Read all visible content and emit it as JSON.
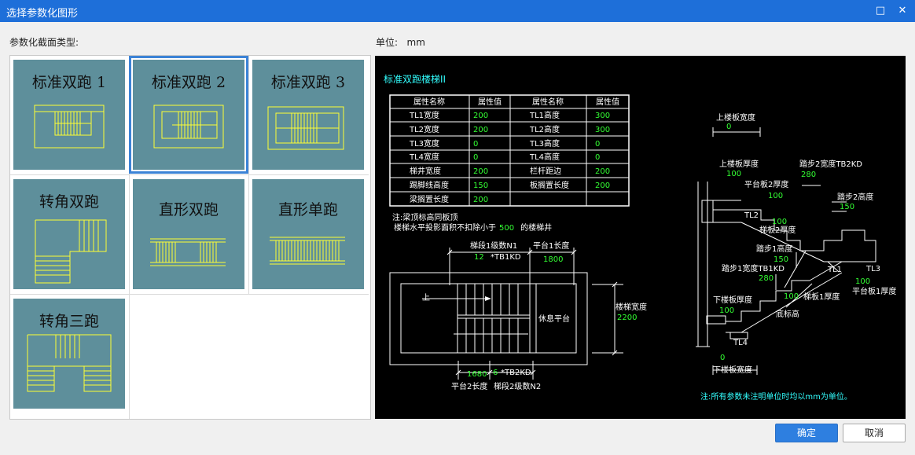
{
  "window": {
    "title": "选择参数化图形"
  },
  "left_label": "参数化截面类型:",
  "unit": {
    "label": "单位:",
    "value": "mm"
  },
  "gallery": {
    "items": [
      {
        "label": "标准双跑 1",
        "selected": false
      },
      {
        "label": "标准双跑 2",
        "selected": true
      },
      {
        "label": "标准双跑 3",
        "selected": false
      },
      {
        "label": "转角双跑",
        "selected": false
      },
      {
        "label": "直形双跑",
        "selected": false
      },
      {
        "label": "直形单跑",
        "selected": false
      },
      {
        "label": "转角三跑",
        "selected": false
      }
    ]
  },
  "preview": {
    "title": "标准双跑楼梯II",
    "table": {
      "headers": [
        "属性名称",
        "属性值",
        "属性名称",
        "属性值"
      ],
      "rows": [
        [
          "TL1宽度",
          "200",
          "TL1高度",
          "300"
        ],
        [
          "TL2宽度",
          "200",
          "TL2高度",
          "300"
        ],
        [
          "TL3宽度",
          "0",
          "TL3高度",
          "0"
        ],
        [
          "TL4宽度",
          "0",
          "TL4高度",
          "0"
        ],
        [
          "梯井宽度",
          "200",
          "栏杆距边",
          "200"
        ],
        [
          "踢脚线高度",
          "150",
          "板搁置长度",
          "200"
        ],
        [
          "梁搁置长度",
          "200",
          "",
          ""
        ]
      ]
    },
    "note1": "注:梁顶标高同板顶",
    "note2_prefix": "楼梯水平投影面积不扣除小于",
    "note2_value": "500",
    "note2_suffix": "的楼梯井",
    "plan": {
      "seg1_label": "梯段1级数N1",
      "seg1_value": "12",
      "seg1_code": "*TB1KD",
      "plat1_label": "平台1长度",
      "plat1_value": "1800",
      "up_label": "上",
      "rest_label": "休息平台",
      "width_label": "楼梯宽度",
      "width_value": "2200",
      "plat2_value": "1680",
      "seg2_value": "6",
      "seg2_code": "*TB2KD",
      "plat2_label": "平台2长度",
      "seg2_label": "梯段2级数N2"
    },
    "section": {
      "upper_slab_width_label": "上楼板宽度",
      "upper_slab_width_value": "0",
      "upper_slab_thk_label": "上楼板厚度",
      "upper_slab_thk_value": "100",
      "step2_width_label": "踏步2宽度TB2KD",
      "step2_width_value": "280",
      "plat2_thk_label": "平台板2厚度",
      "plat2_thk_value": "100",
      "step2_height_label": "踏步2高度",
      "step2_height_value": "150",
      "tl2": "TL2",
      "slab2_value": "100",
      "slab2_label": "梯板2厚度",
      "step1_height_label": "踏步1高度",
      "step1_height_value": "150",
      "step1_width_label": "踏步1宽度TB1KD",
      "step1_width_value": "280",
      "tl1": "TL1",
      "tl3": "TL3",
      "plat1_thk_value": "100",
      "plat1_thk_label": "平台板1厚度",
      "lower_slab_thk_label": "下楼板厚度",
      "lower_slab_thk_value": "100",
      "slab1_value": "100",
      "slab1_label": "梯板1厚度",
      "bottom_elev_label": "底标高",
      "tl4": "TL4",
      "lower_slab_width_value": "0",
      "lower_slab_width_label": "下楼板宽度"
    },
    "footnote": "注:所有参数未注明单位时均以mm为单位。"
  },
  "buttons": {
    "ok": "确定",
    "cancel": "取消"
  },
  "colors": {
    "titlebar": "#1e6fd9",
    "tile": "#5e8f9b",
    "drawing_yellow": "#ffff33",
    "value_green": "#33ff33",
    "cyan": "#33ffff",
    "ok_button": "#2e7fe0"
  }
}
